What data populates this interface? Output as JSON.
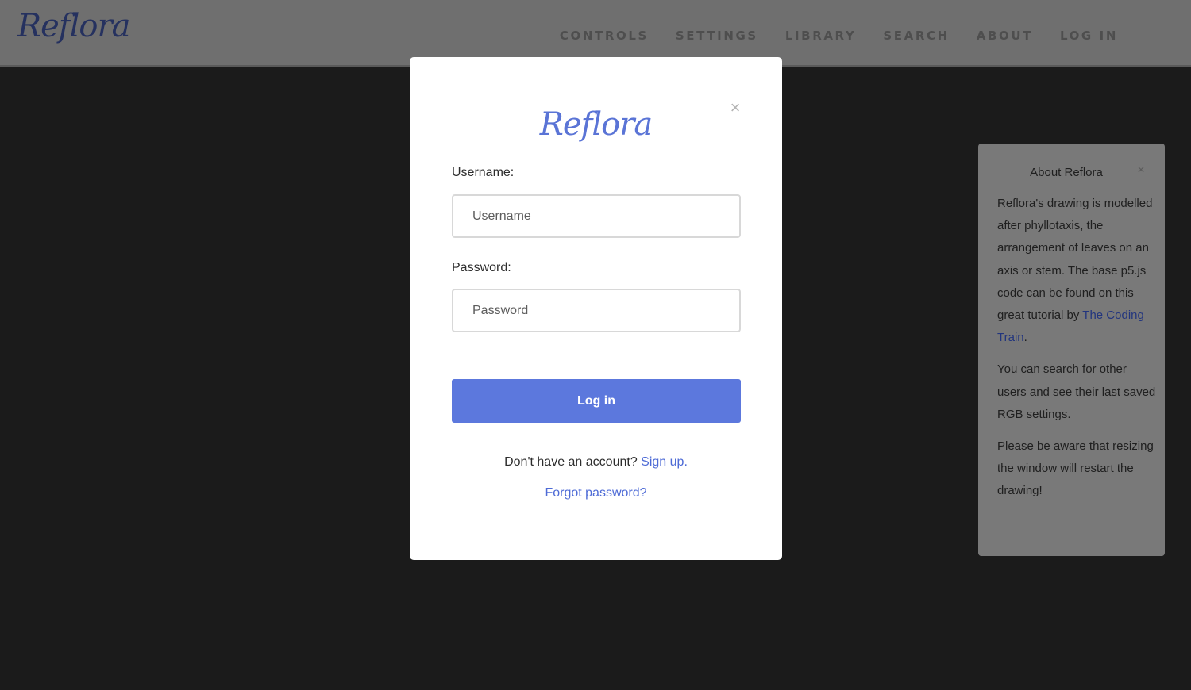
{
  "header": {
    "logo": "Reflora",
    "nav": [
      "CONTROLS",
      "SETTINGS",
      "LIBRARY",
      "SEARCH",
      "ABOUT",
      "LOG IN"
    ]
  },
  "modal": {
    "logo": "Reflora",
    "close_icon": "×",
    "username_label": "Username:",
    "username_placeholder": "Username",
    "username_value": "",
    "password_label": "Password:",
    "password_placeholder": "Password",
    "password_value": "",
    "login_button": "Log in",
    "no_account_text": "Don't have an account?",
    "signup_link": "Sign up.",
    "forgot_link": "Forgot password?"
  },
  "about": {
    "title": "About Reflora",
    "close_icon": "×",
    "para1_text": "Reflora's drawing is modelled after phyllotaxis, the arrangement of leaves on an axis or stem. The base p5.js code can be found on this great tutorial by",
    "para1_link": "The Coding Train",
    "para1_end": ".",
    "para2": "You can search for other users and see their last saved RGB settings.",
    "para3": "Please be aware that resizing the window will restart the drawing!"
  },
  "colors": {
    "accent": "#5c78dd",
    "link": "#4e6bd6",
    "overlay_bg": "#1b1b1b",
    "header_dimmed": "#6f6f6f",
    "about_panel_dimmed": "#797979"
  },
  "icons": {
    "modal_close": "close-icon",
    "about_close": "close-icon"
  }
}
